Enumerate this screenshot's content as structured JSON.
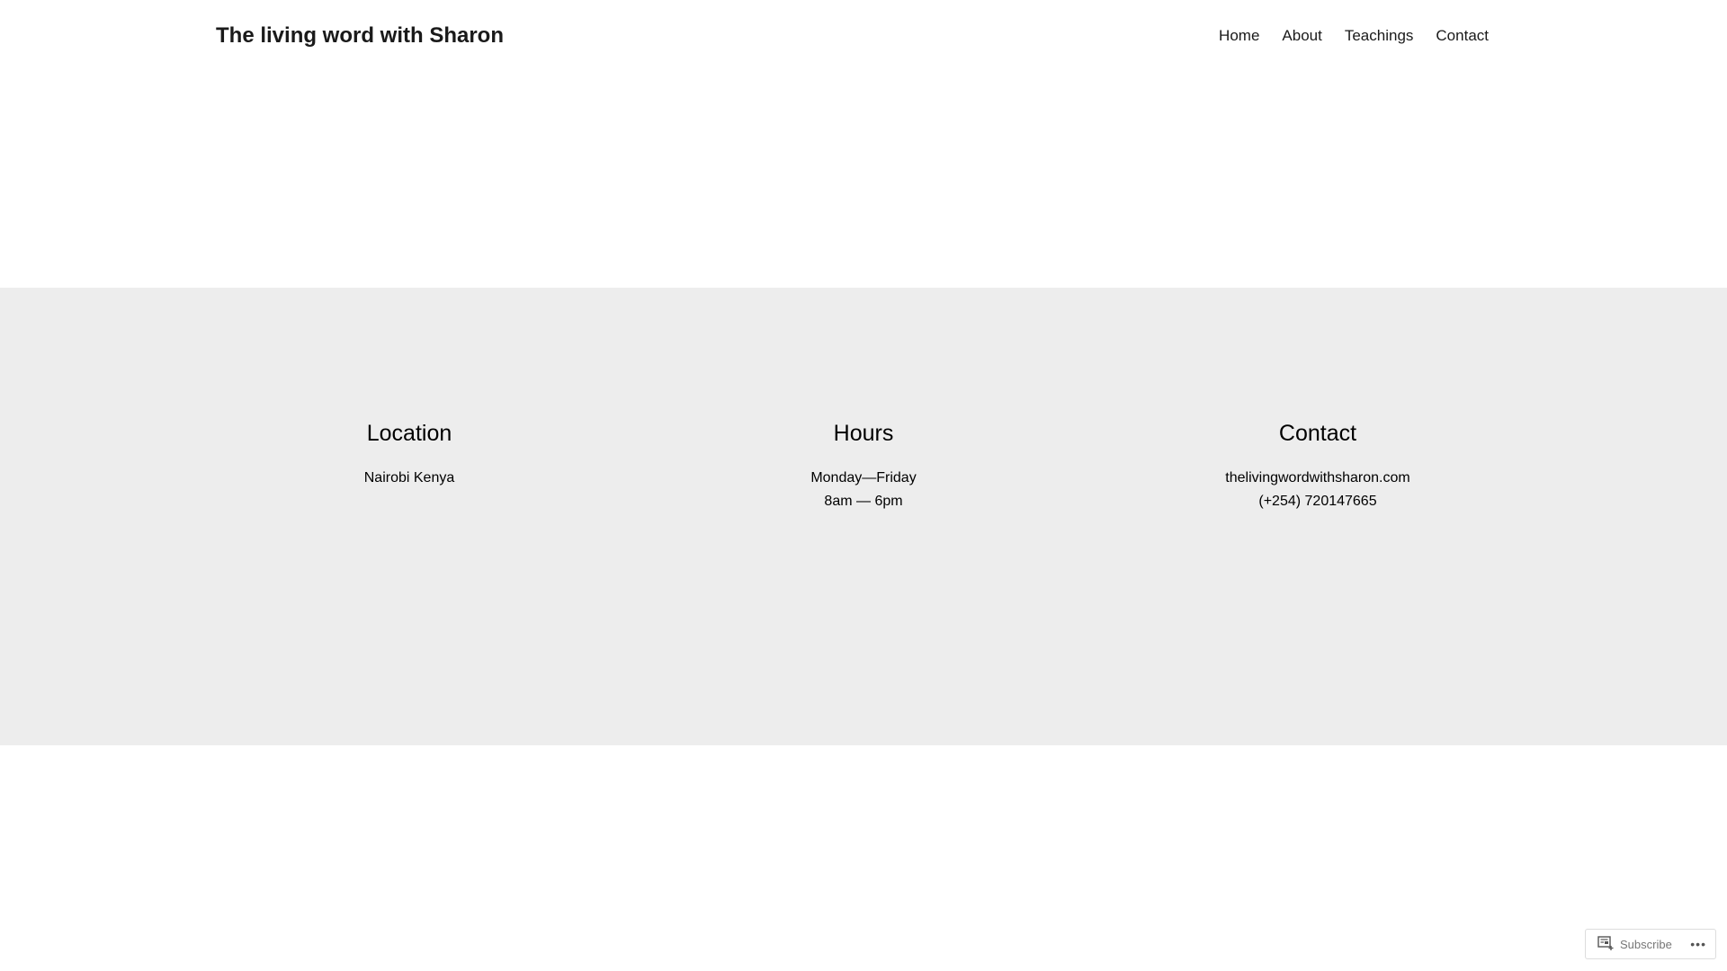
{
  "header": {
    "site_title": "The living word with Sharon",
    "nav": [
      "Home",
      "About",
      "Teachings",
      "Contact"
    ]
  },
  "info": {
    "location": {
      "heading": "Location",
      "lines": [
        "Nairobi Kenya"
      ]
    },
    "hours": {
      "heading": "Hours",
      "lines": [
        "Monday—Friday",
        "8am — 6pm"
      ]
    },
    "contact": {
      "heading": "Contact",
      "lines": [
        "thelivingwordwithsharon.com",
        "(+254) 720147665"
      ]
    }
  },
  "subscribe_bar": {
    "label": "Subscribe",
    "icon": "reader-subscribe-icon",
    "more": "more-options-icon"
  },
  "colors": {
    "band": "#ededed"
  }
}
